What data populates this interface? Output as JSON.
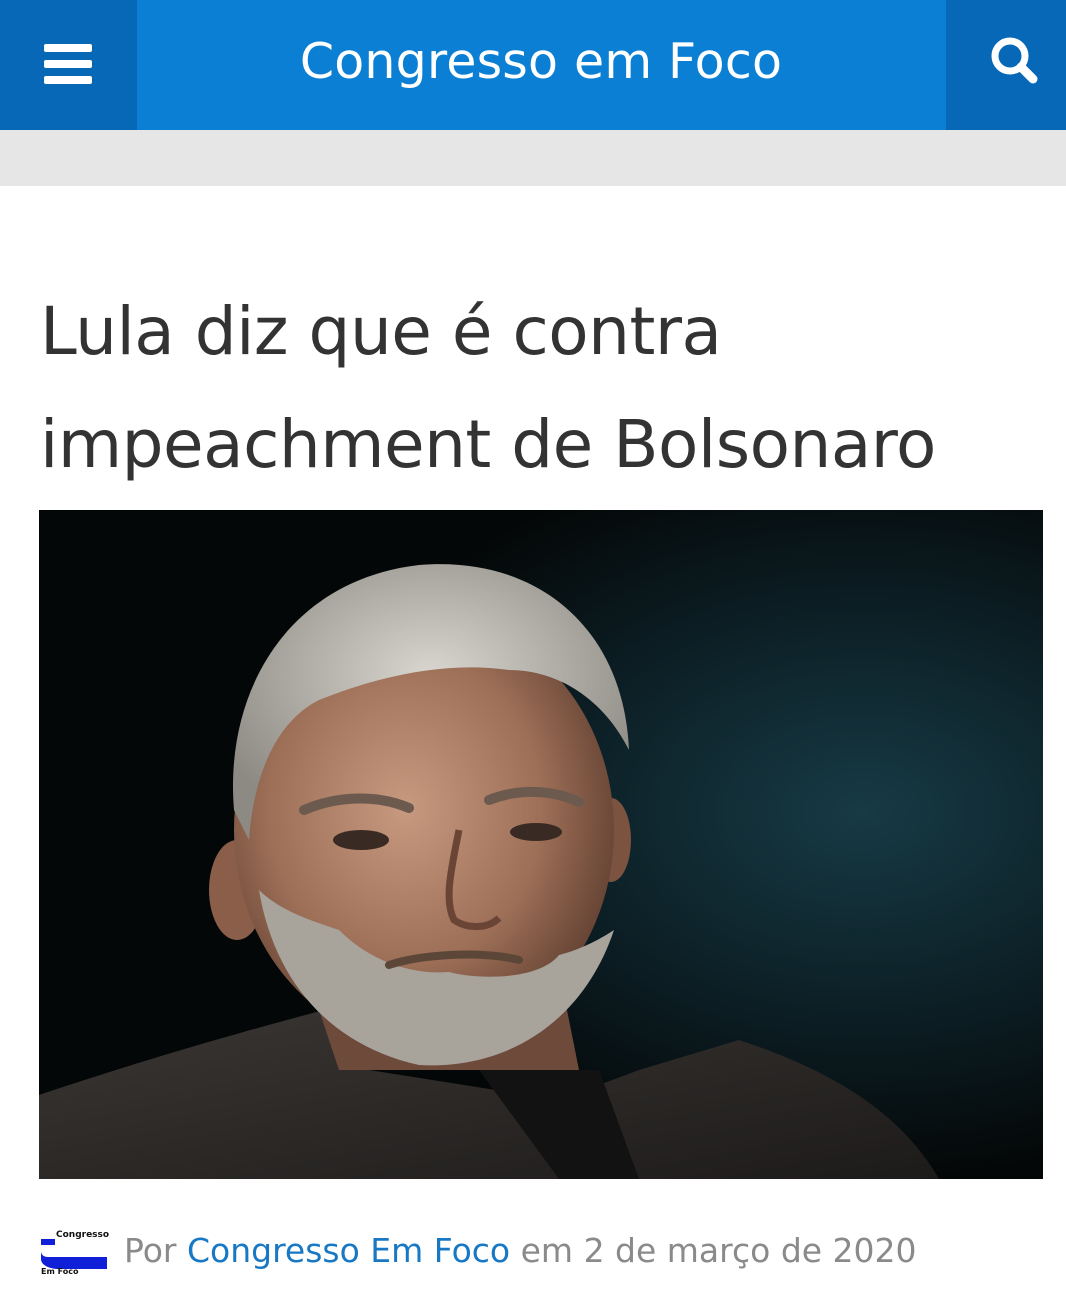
{
  "header": {
    "site_title": "Congresso em Foco",
    "menu_icon": "hamburger-menu-icon",
    "search_icon": "search-icon",
    "colors": {
      "bar": "#0a7fd4",
      "button": "#0768b7",
      "subbar": "#e6e6e6"
    }
  },
  "article": {
    "title": "Lula diz que é contra impeachment de Bolsonaro",
    "byline": {
      "prefix": "Por",
      "author": "Congresso Em Foco",
      "date_prefix": "em",
      "date": "2 de março de 2020",
      "avatar": {
        "line1": "Congresso",
        "line2": "Em Foco"
      }
    },
    "colors": {
      "title": "#333333",
      "byline": "#8a8a8a",
      "author_link": "#1878c3"
    }
  }
}
